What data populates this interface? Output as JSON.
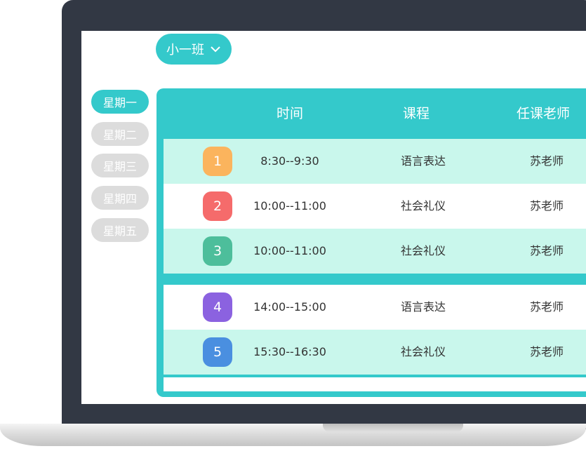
{
  "class_selector": {
    "label": "小一班"
  },
  "days": [
    {
      "label": "星期一",
      "active": true
    },
    {
      "label": "星期二",
      "active": false
    },
    {
      "label": "星期三",
      "active": false
    },
    {
      "label": "星期四",
      "active": false
    },
    {
      "label": "星期五",
      "active": false
    }
  ],
  "table": {
    "headers": {
      "time": "时间",
      "course": "课程",
      "teacher": "任课老师"
    },
    "rows": [
      {
        "index": "1",
        "time": "8:30--9:30",
        "course": "语言表达",
        "teacher": "苏老师",
        "color": "#fbb45d"
      },
      {
        "index": "2",
        "time": "10:00--11:00",
        "course": "社会礼仪",
        "teacher": "苏老师",
        "color": "#f56b6b"
      },
      {
        "index": "3",
        "time": "10:00--11:00",
        "course": "社会礼仪",
        "teacher": "苏老师",
        "color": "#4dbe9b"
      },
      {
        "index": "4",
        "time": "14:00--15:00",
        "course": "语言表达",
        "teacher": "苏老师",
        "color": "#8b62e0"
      },
      {
        "index": "5",
        "time": "15:30--16:30",
        "course": "社会礼仪",
        "teacher": "苏老师",
        "color": "#4a8fe0"
      }
    ]
  },
  "colors": {
    "accent": "#34c9cb",
    "row_alt": "#c9f7ec",
    "tab_inactive": "#dcdcdc",
    "bezel": "#323844"
  }
}
